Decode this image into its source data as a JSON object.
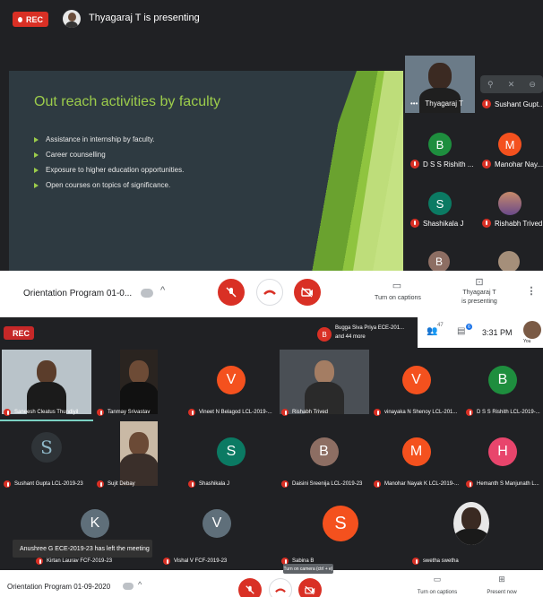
{
  "top": {
    "rec_label": "REC",
    "presenting_text": "Thyagaraj T is presenting",
    "slide": {
      "title": "Out reach activities by faculty",
      "bullets": [
        "Assistance in internship by faculty.",
        "Career counselling",
        "Exposure to higher education opportunities.",
        "Open courses on topics of significance."
      ]
    },
    "side_tiles": [
      {
        "name": "Thyagaraj T",
        "initial": ""
      },
      {
        "name": "Sushant Gupt...",
        "initial": ""
      },
      {
        "name": "D S S Rishith ...",
        "initial": "B"
      },
      {
        "name": "Manohar Nay...",
        "initial": "M"
      },
      {
        "name": "Shashikala J",
        "initial": "S"
      },
      {
        "name": "Rishabh Trived",
        "initial": ""
      },
      {
        "name": "",
        "initial": "B"
      },
      {
        "name": "",
        "initial": ""
      }
    ],
    "controls": {
      "meeting_title": "Orientation Program 01-0...",
      "captions_label": "Turn on captions",
      "presenting_label_1": "Thyagaraj T",
      "presenting_label_2": "is presenting"
    }
  },
  "bottom": {
    "rec_label": "REC",
    "participants_text_1": "Bugga Siva Priya ECE-201...",
    "participants_text_2": "and 44 more",
    "participants_initial": "B",
    "people_count": "47",
    "chat_count": "6",
    "time": "3:31 PM",
    "you_label": "You",
    "grid": [
      {
        "name": "Saneesh Cleatus Thundiyil",
        "initial": ""
      },
      {
        "name": "Tanmay Srivastav",
        "initial": ""
      },
      {
        "name": "Vineet N Belagod LCL-2019-...",
        "initial": "V"
      },
      {
        "name": "Rishabh Trived",
        "initial": ""
      },
      {
        "name": "vinayaka N Shenoy LCL-201...",
        "initial": "V"
      },
      {
        "name": "D S S Rishith LCL-2019-...",
        "initial": "B"
      },
      {
        "name": "Sushant Gupta LCL-2019-23",
        "initial": ""
      },
      {
        "name": "Sujit Debay",
        "initial": ""
      },
      {
        "name": "Shashikala J",
        "initial": "S"
      },
      {
        "name": "Daisini Sreenija LCL-2019-23",
        "initial": "B"
      },
      {
        "name": "Manohar Nayak K LCL-2019-...",
        "initial": "M"
      },
      {
        "name": "Hemanth S Manjunath L...",
        "initial": "H"
      },
      {
        "name": "Kirtan Laurav FCF-2019-23",
        "initial": "K"
      },
      {
        "name": "Vishal V FCF-2019-23",
        "initial": "V"
      },
      {
        "name": "Sabina B",
        "initial": "S"
      },
      {
        "name": "swetha swetha",
        "initial": ""
      }
    ],
    "toast": "Anushree G ECE-2019-23 has left the meeting",
    "tooltip": "Turn on camera (ctrl + e)",
    "controls": {
      "meeting_title": "Orientation Program 01-09-2020",
      "captions_label": "Turn on captions",
      "present_label": "Present now"
    }
  },
  "colors": {
    "red": "#d93025",
    "green_avatar": "#1e8e3e",
    "teal_avatar": "#0b7a63",
    "orange_avatar": "#f4511e",
    "pink_avatar": "#e8456c",
    "brown_avatar": "#8d6e63",
    "slate_avatar": "#5f6f7a"
  }
}
